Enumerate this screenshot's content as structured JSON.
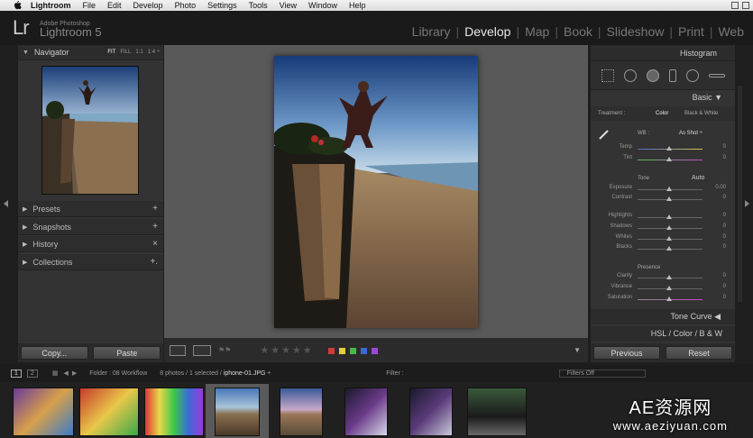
{
  "menubar": {
    "apple_icon": "apple-icon",
    "items": [
      "Lightroom",
      "File",
      "Edit",
      "Develop",
      "Photo",
      "Settings",
      "Tools",
      "View",
      "Window",
      "Help"
    ]
  },
  "identity": {
    "logo": "Lr",
    "subtitle": "Adobe Photoshop",
    "name": "Lightroom 5"
  },
  "modules": [
    "Library",
    "Develop",
    "Map",
    "Book",
    "Slideshow",
    "Print",
    "Web"
  ],
  "modules_active": "Develop",
  "navigator": {
    "title": "Navigator",
    "options": [
      "FIT",
      "FILL",
      "1:1",
      "1:4 ÷"
    ]
  },
  "left_panels": [
    {
      "label": "Presets",
      "action": "+"
    },
    {
      "label": "Snapshots",
      "action": "+"
    },
    {
      "label": "History",
      "action": "×"
    },
    {
      "label": "Collections",
      "action": "+."
    }
  ],
  "left_buttons": {
    "copy": "Copy...",
    "paste": "Paste"
  },
  "toolbar": {
    "stars": "★★★★★",
    "labels": [
      "#d23a3a",
      "#e0d03a",
      "#47b947",
      "#3a6ad2",
      "#9a4ad2"
    ]
  },
  "right_panel": {
    "histogram": "Histogram",
    "basic": "Basic",
    "treatment_label": "Treatment :",
    "treatment_color": "Color",
    "treatment_bw": "Black & White",
    "wb_label": "WB :",
    "wb_value": "As Shot ÷",
    "tone_label": "Tone",
    "auto": "Auto",
    "presence_label": "Presence",
    "sliders_wb": [
      {
        "label": "Temp",
        "value": "0"
      },
      {
        "label": "Tint",
        "value": "0"
      }
    ],
    "sliders_tone1": [
      {
        "label": "Exposure",
        "value": "0.00"
      },
      {
        "label": "Contrast",
        "value": "0"
      }
    ],
    "sliders_tone2": [
      {
        "label": "Highlights",
        "value": "0"
      },
      {
        "label": "Shadows",
        "value": "0"
      },
      {
        "label": "Whites",
        "value": "0"
      },
      {
        "label": "Blacks",
        "value": "0"
      }
    ],
    "sliders_presence": [
      {
        "label": "Clarity",
        "value": "0"
      },
      {
        "label": "Vibrance",
        "value": "0"
      },
      {
        "label": "Saturation",
        "value": "0"
      }
    ],
    "tone_curve": "Tone Curve",
    "hsl": "HSL",
    "hsl_color": "Color",
    "hsl_bw": "B & W"
  },
  "right_buttons": {
    "previous": "Previous",
    "reset": "Reset"
  },
  "filmstrip_bar": {
    "page1": "1",
    "page2": "2",
    "folder": "Folder : 08 Workflow",
    "count": "8 photos / 1 selected /",
    "filename": "iphone-01.JPG ÷",
    "filter": "Filter :",
    "filter_value": "Filters Off"
  },
  "watermark": {
    "line1": "AE资源网",
    "line2": "www.aeziyuan.com"
  }
}
